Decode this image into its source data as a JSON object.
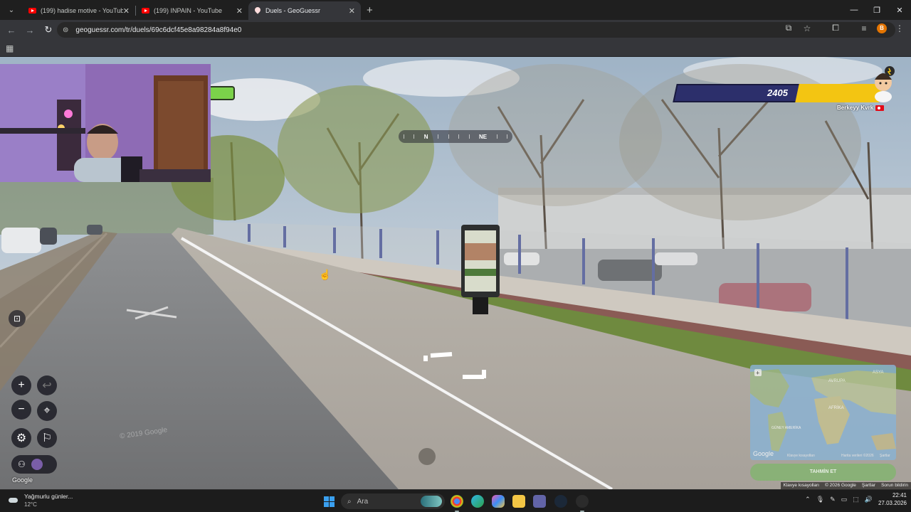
{
  "browser": {
    "tabs": [
      {
        "title": "(199) hadise motive - YouTube",
        "active": false
      },
      {
        "title": "(199) INPAIN - YouTube",
        "active": false
      },
      {
        "title": "Duels - GeoGuessr",
        "active": true
      }
    ],
    "url": "geoguessr.com/tr/duels/69c6dcf45e8a98284a8f94e0",
    "profile_initial": "B"
  },
  "game": {
    "compass_left": "N",
    "compass_right": "NE",
    "opponent_score": "2405",
    "opponent_name": "Berkeyy Kvrk",
    "opponent_flag": "TR",
    "brand": "Google",
    "watermark": "© 2019 Google",
    "guess_button": "TAHMİN ET",
    "minimap_labels": {
      "asia": "ASYA",
      "europe": "AVRUPA",
      "africa": "AFRİKA",
      "south_america": "GÜNEY\nAMERİKA"
    },
    "map_attribution": [
      "Klavye kısayolları",
      "Harita verileri ©2026",
      "Şartlar"
    ],
    "sv_attribution": [
      "Klavye kısayolları",
      "© 2026 Google",
      "Şartlar",
      "Sorun bildirin"
    ]
  },
  "taskbar": {
    "weather_title": "Yağmurlu günler...",
    "weather_temp": "12°C",
    "search_placeholder": "Ara",
    "time": "22:41",
    "date": "27.03.2026"
  },
  "colors": {
    "score_bar": "#2c2f6b",
    "score_fill": "#f3c512",
    "health_green": "#7bd24a",
    "taskbar": "#1c1c1c"
  }
}
